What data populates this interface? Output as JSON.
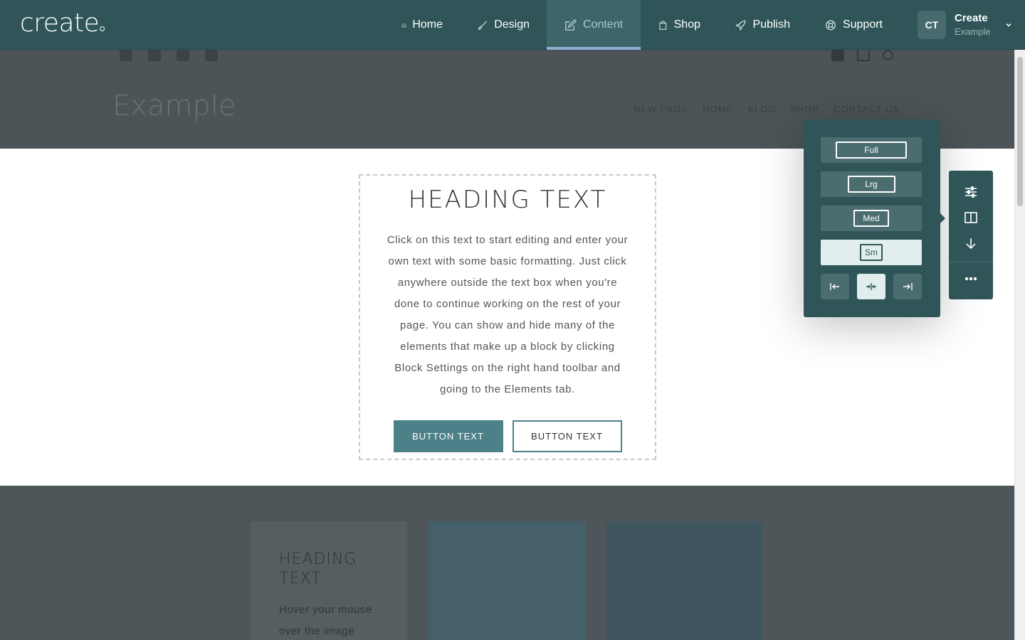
{
  "app": {
    "logo": "create",
    "nav": [
      {
        "label": "Home",
        "icon": "home-icon"
      },
      {
        "label": "Design",
        "icon": "brush-icon"
      },
      {
        "label": "Content",
        "icon": "edit-icon",
        "active": true
      },
      {
        "label": "Shop",
        "icon": "bag-icon"
      },
      {
        "label": "Publish",
        "icon": "rocket-icon"
      },
      {
        "label": "Support",
        "icon": "lifebuoy-icon"
      }
    ],
    "account": {
      "initials": "CT",
      "name": "Create",
      "site": "Example"
    }
  },
  "site": {
    "title": "Example",
    "nav": [
      "NEW PAGE",
      "HOME",
      "BLOG",
      "SHOP",
      "CONTACT US"
    ]
  },
  "content_block": {
    "heading": "HEADING TEXT",
    "paragraph": "Click on this text to start editing and enter your own text with some basic formatting. Just click anywhere outside the text box when you're done to continue working on the rest of your page. You can show and hide many of the elements that make up a block by clicking Block Settings on the right hand toolbar and going to the Elements tab.",
    "button_primary": "BUTTON TEXT",
    "button_secondary": "BUTTON TEXT"
  },
  "lower_block": {
    "card_heading": "HEADING TEXT",
    "card_text": "Hover your mouse over the image"
  },
  "width_panel": {
    "options": [
      "Full",
      "Lrg",
      "Med",
      "Sm"
    ],
    "selected": "Sm",
    "alignment": [
      "align-left",
      "align-center",
      "align-right"
    ],
    "selected_alignment": "align-center"
  },
  "block_toolbar": {
    "tools": [
      "settings-sliders-icon",
      "columns-layout-icon",
      "arrow-down-icon",
      "more-icon"
    ]
  },
  "colors": {
    "topbar": "#2f5558",
    "accent": "#4d8189",
    "active_tab_underline": "#8faed6"
  }
}
